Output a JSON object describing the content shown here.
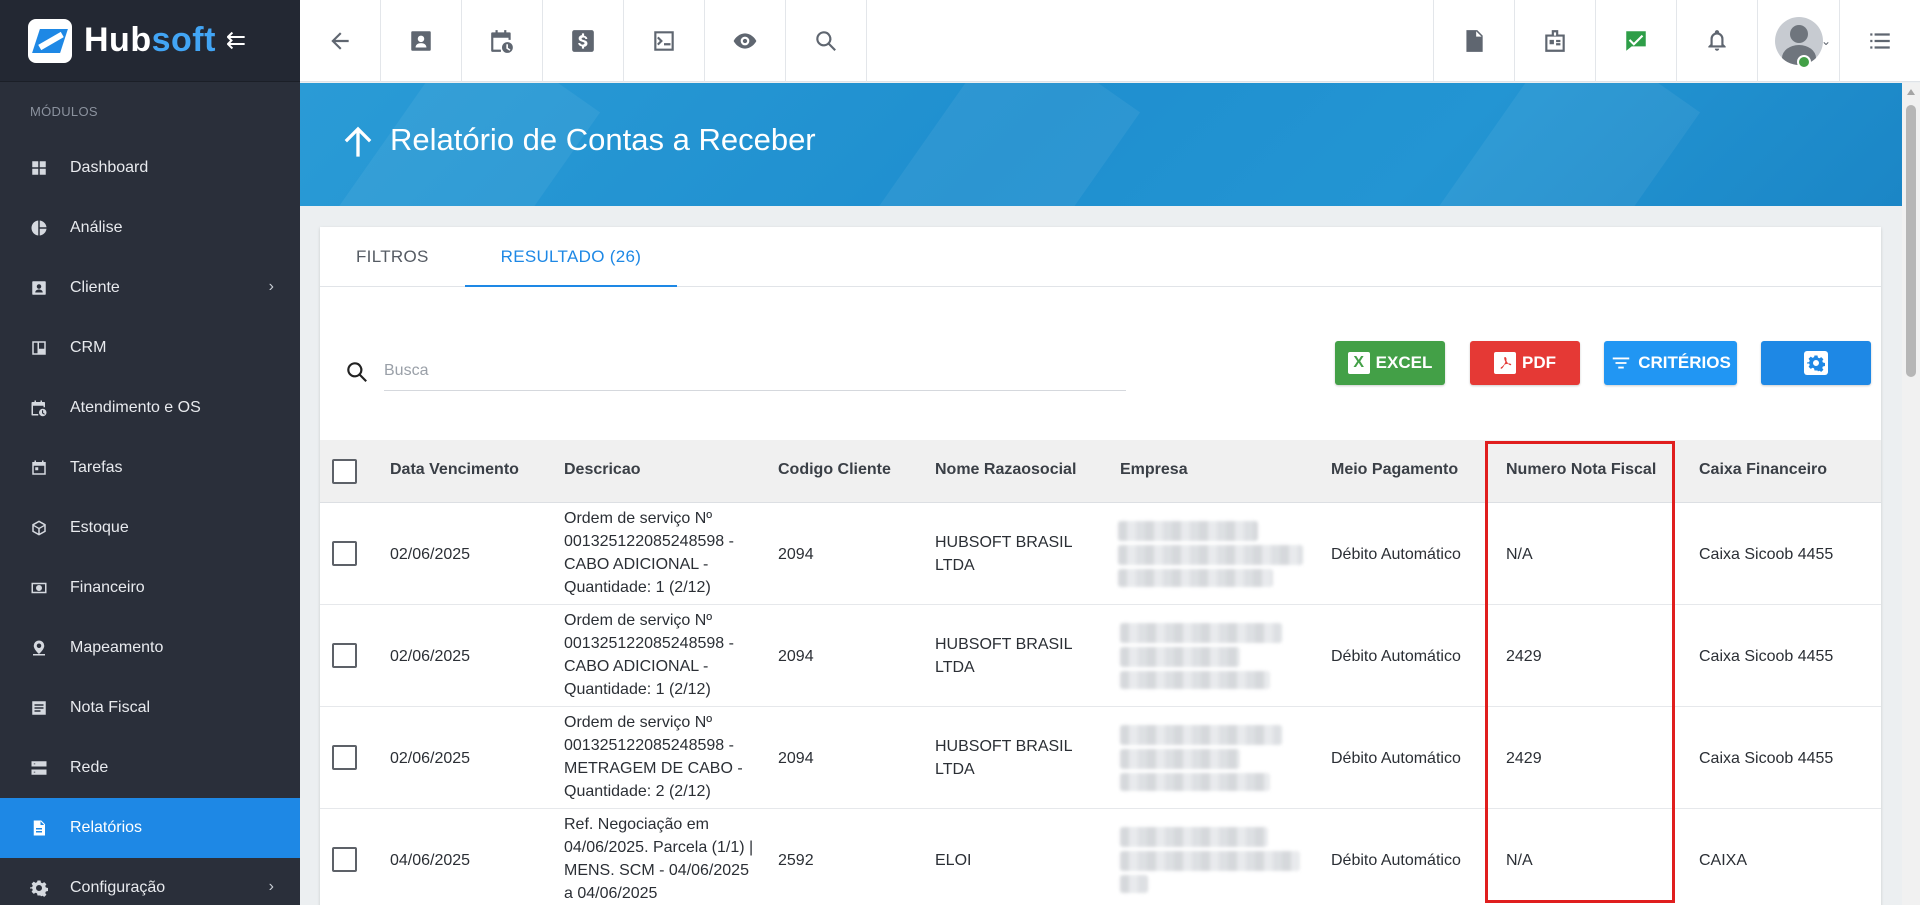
{
  "brand": {
    "hub": "Hub",
    "soft": "soft",
    "collapse_icon": "collapse-arrow-icon"
  },
  "sidebar": {
    "section_label": "MÓDULOS",
    "items": [
      {
        "label": "Dashboard",
        "icon": "dashboard-icon",
        "has_children": false
      },
      {
        "label": "Análise",
        "icon": "pie-chart-icon",
        "has_children": false
      },
      {
        "label": "Cliente",
        "icon": "contact-card-icon",
        "has_children": true
      },
      {
        "label": "CRM",
        "icon": "kanban-icon",
        "has_children": false
      },
      {
        "label": "Atendimento e OS",
        "icon": "calendar-clock-icon",
        "has_children": false
      },
      {
        "label": "Tarefas",
        "icon": "calendar-icon",
        "has_children": false
      },
      {
        "label": "Estoque",
        "icon": "box-icon",
        "has_children": false
      },
      {
        "label": "Financeiro",
        "icon": "money-icon",
        "has_children": false
      },
      {
        "label": "Mapeamento",
        "icon": "map-pin-icon",
        "has_children": false
      },
      {
        "label": "Nota Fiscal",
        "icon": "document-list-icon",
        "has_children": false
      },
      {
        "label": "Rede",
        "icon": "server-icon",
        "has_children": false
      },
      {
        "label": "Relatórios",
        "icon": "report-file-icon",
        "has_children": false,
        "active": true
      },
      {
        "label": "Configuração",
        "icon": "gear-icon",
        "has_children": true
      }
    ]
  },
  "topbar": {
    "left_icons": [
      "back-arrow-icon",
      "contact-card-icon",
      "calendar-clock-icon",
      "dollar-icon",
      "terminal-icon",
      "eye-icon",
      "search-icon"
    ],
    "right_icons": [
      "pdf-file-icon",
      "id-badge-icon",
      "chat-check-icon",
      "bell-icon"
    ],
    "menu_icon": "list-menu-icon"
  },
  "header": {
    "title": "Relatório de Contas a Receber"
  },
  "tabs": [
    {
      "label": "FILTROS",
      "active": false
    },
    {
      "label": "RESULTADO (26)",
      "active": true
    }
  ],
  "search": {
    "placeholder": "Busca",
    "value": ""
  },
  "actions": {
    "excel": "EXCEL",
    "excel_badge": "X",
    "pdf": "PDF",
    "criterios": "CRITÉRIOS"
  },
  "table": {
    "columns": [
      "Data Vencimento",
      "Descricao",
      "Codigo Cliente",
      "Nome Razaosocial",
      "Empresa",
      "Meio Pagamento",
      "Numero Nota Fiscal",
      "Caixa Financeiro"
    ],
    "rows": [
      {
        "data": "02/06/2025",
        "descricao": [
          "Ordem de serviço Nº",
          "001325122085248598 -",
          "CABO ADICIONAL -",
          "Quantidade: 1 (2/12)"
        ],
        "codigo": "2094",
        "nome": [
          "HUBSOFT BRASIL",
          "LTDA"
        ],
        "meio": "Débito Automático",
        "nota": "N/A",
        "caixa": "Caixa Sicoob 4455"
      },
      {
        "data": "02/06/2025",
        "descricao": [
          "Ordem de serviço Nº",
          "001325122085248598 -",
          "CABO ADICIONAL -",
          "Quantidade: 1 (2/12)"
        ],
        "codigo": "2094",
        "nome": [
          "HUBSOFT BRASIL",
          "LTDA"
        ],
        "meio": "Débito Automático",
        "nota": "2429",
        "caixa": "Caixa Sicoob 4455"
      },
      {
        "data": "02/06/2025",
        "descricao": [
          "Ordem de serviço Nº",
          "001325122085248598 -",
          "METRAGEM DE CABO -",
          "Quantidade: 2 (2/12)"
        ],
        "codigo": "2094",
        "nome": [
          "HUBSOFT BRASIL",
          "LTDA"
        ],
        "meio": "Débito Automático",
        "nota": "2429",
        "caixa": "Caixa Sicoob 4455"
      },
      {
        "data": "04/06/2025",
        "descricao": [
          "Ref. Negociação em",
          "04/06/2025. Parcela (1/1) |",
          "MENS. SCM - 04/06/2025",
          "a 04/06/2025"
        ],
        "codigo": "2592",
        "nome": [
          "ELOI"
        ],
        "meio": "Débito Automático",
        "nota": "N/A",
        "caixa": "CAIXA"
      }
    ]
  }
}
